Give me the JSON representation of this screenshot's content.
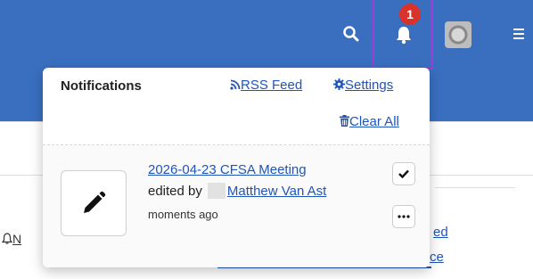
{
  "topbar": {
    "notification_count": "1",
    "icons": [
      "search-icon",
      "bell-icon",
      "avatar",
      "hamburger-icon"
    ],
    "bg_color": "#3a6fc0",
    "highlight_color": "#9b3fd6"
  },
  "notifications": {
    "title": "Notifications",
    "rss_label": "RSS Feed",
    "settings_label": "Settings",
    "clear_all_label": "Clear All",
    "items": [
      {
        "title": "2026-04-23 CFSA Meeting",
        "edited_by_prefix": "edited by",
        "user": "Matthew Van Ast",
        "time": "moments ago",
        "icon": "pencil-icon"
      }
    ]
  },
  "background_page": {
    "left_link_fragment": "N",
    "link_fragment_1": "ed",
    "link_fragment_2": "ce"
  }
}
